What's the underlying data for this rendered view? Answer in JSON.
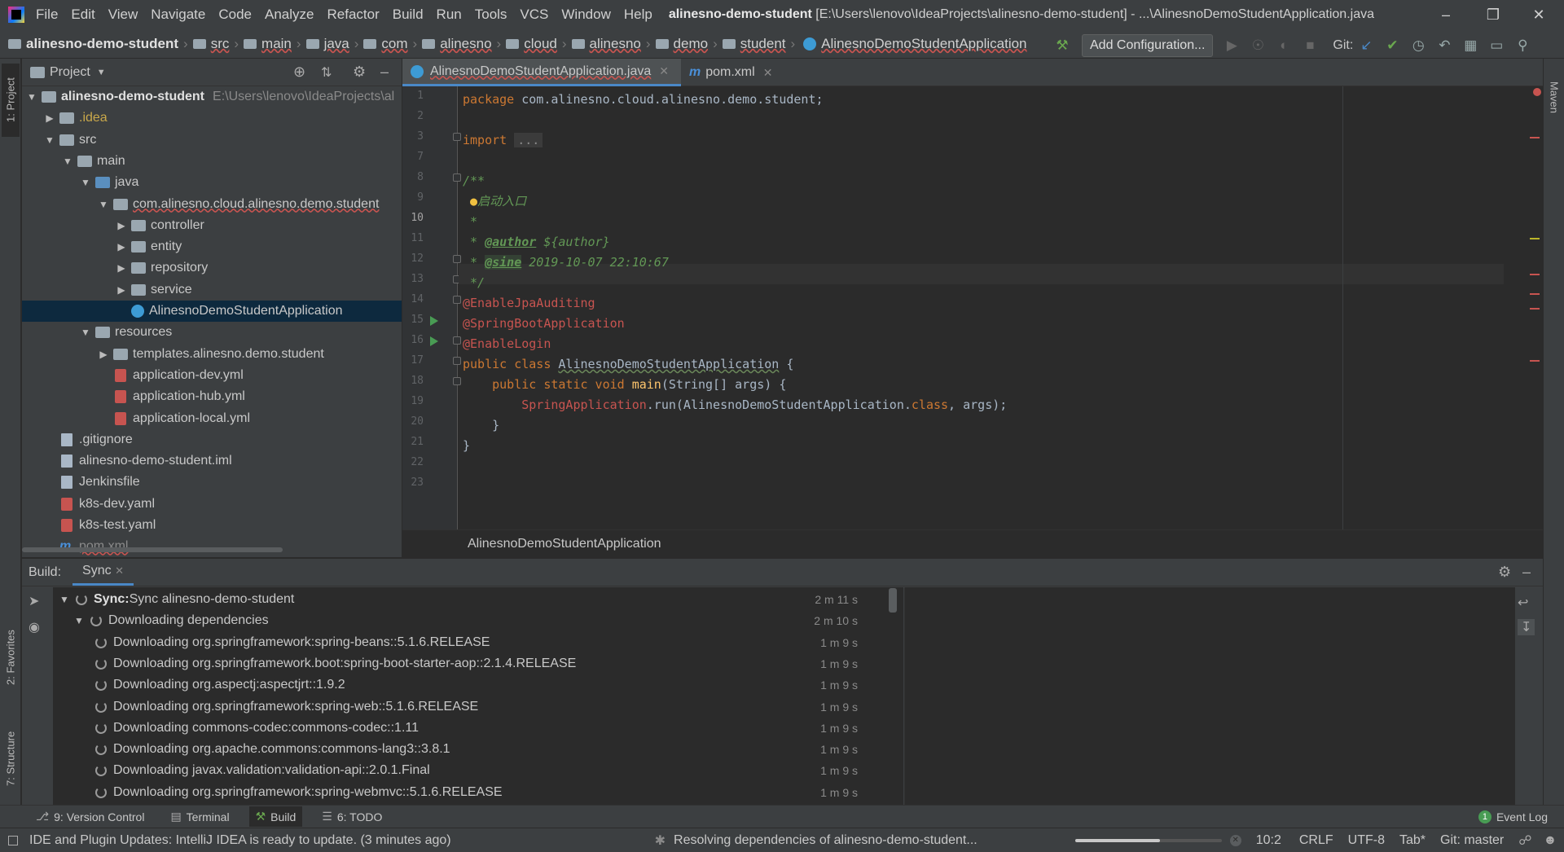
{
  "titlebar": {
    "menus": [
      "File",
      "Edit",
      "View",
      "Navigate",
      "Code",
      "Analyze",
      "Refactor",
      "Build",
      "Run",
      "Tools",
      "VCS",
      "Window",
      "Help"
    ],
    "project_name": "alinesno-demo-student",
    "project_path": "[E:\\Users\\lenovo\\IdeaProjects\\alinesno-demo-student] - ...\\AlinesnoDemoStudentApplication.java"
  },
  "navbar": {
    "crumbs": [
      "alinesno-demo-student",
      "src",
      "main",
      "java",
      "com",
      "alinesno",
      "cloud",
      "alinesno",
      "demo",
      "student",
      "AlinesnoDemoStudentApplication"
    ],
    "add_config": "Add Configuration...",
    "git_label": "Git:"
  },
  "project": {
    "title": "Project",
    "root_name": "alinesno-demo-student",
    "root_path": "E:\\Users\\lenovo\\IdeaProjects\\al",
    "items": [
      {
        "label": ".idea"
      },
      {
        "label": "src"
      },
      {
        "label": "main"
      },
      {
        "label": "java"
      },
      {
        "label": "com.alinesno.cloud.alinesno.demo.student"
      },
      {
        "label": "controller"
      },
      {
        "label": "entity"
      },
      {
        "label": "repository"
      },
      {
        "label": "service"
      },
      {
        "label": "AlinesnoDemoStudentApplication"
      },
      {
        "label": "resources"
      },
      {
        "label": "templates.alinesno.demo.student"
      },
      {
        "label": "application-dev.yml"
      },
      {
        "label": "application-hub.yml"
      },
      {
        "label": "application-local.yml"
      },
      {
        "label": ".gitignore"
      },
      {
        "label": "alinesno-demo-student.iml"
      },
      {
        "label": "Jenkinsfile"
      },
      {
        "label": "k8s-dev.yaml"
      },
      {
        "label": "k8s-test.yaml"
      },
      {
        "label": "pom.xml"
      }
    ]
  },
  "editor": {
    "tabs": [
      {
        "label": "AlinesnoDemoStudentApplication.java"
      },
      {
        "label": "pom.xml"
      }
    ],
    "line_numbers": [
      "1",
      "2",
      "3",
      "7",
      "8",
      "9",
      "10",
      "11",
      "12",
      "13",
      "14",
      "15",
      "16",
      "17",
      "18",
      "19",
      "20",
      "21",
      "22",
      "23"
    ],
    "code": {
      "l1_kw": "package",
      "l1_rest": " com.alinesno.cloud.alinesno.demo.student;",
      "l3_kw": "import",
      "l3_fold": "...",
      "l8": "/**",
      "l9": "启动入口",
      "l10": " *",
      "l11_tag": "@author",
      "l11_rest": " ${author}",
      "l12_tag": "@sine",
      "l12_rest": " 2019-10-07 22:10:67",
      "l13": " */",
      "l14": "@EnableJpaAuditing",
      "l15": "@SpringBootApplication",
      "l16": "@EnableLogin",
      "l17_kw": "public class",
      "l17_name": "AlinesnoDemoStudentApplication",
      "l17_rest": " {",
      "l18_kw": "public static void",
      "l18_fn": "main",
      "l18_rest": "(String[] args) {",
      "l19_cls": "SpringApplication",
      "l19_a": ".run(AlinesnoDemoStudentApplication.",
      "l19_kw": "class",
      "l19_b": ", args);",
      "l20": "    }",
      "l21": "}"
    },
    "breadcrumb": "AlinesnoDemoStudentApplication"
  },
  "build": {
    "label": "Build:",
    "tab": "Sync",
    "rows": [
      {
        "bold": "Sync:",
        "text": " Sync alinesno-demo-student",
        "time": "2 m 11 s"
      },
      {
        "text": "Downloading dependencies",
        "time": "2 m 10 s"
      },
      {
        "text": "Downloading org.springframework:spring-beans::5.1.6.RELEASE",
        "time": "1 m 9 s"
      },
      {
        "text": "Downloading org.springframework.boot:spring-boot-starter-aop::2.1.4.RELEASE",
        "time": "1 m 9 s"
      },
      {
        "text": "Downloading org.aspectj:aspectjrt::1.9.2",
        "time": "1 m 9 s"
      },
      {
        "text": "Downloading org.springframework:spring-web::5.1.6.RELEASE",
        "time": "1 m 9 s"
      },
      {
        "text": "Downloading commons-codec:commons-codec::1.11",
        "time": "1 m 9 s"
      },
      {
        "text": "Downloading org.apache.commons:commons-lang3::3.8.1",
        "time": "1 m 9 s"
      },
      {
        "text": "Downloading javax.validation:validation-api::2.0.1.Final",
        "time": "1 m 9 s"
      },
      {
        "text": "Downloading org.springframework:spring-webmvc::5.1.6.RELEASE",
        "time": "1 m 9 s"
      }
    ]
  },
  "sidebar_tabs": {
    "project": "1: Project",
    "favorites": "2: Favorites",
    "structure": "7: Structure",
    "maven": "Maven"
  },
  "tooltabs": {
    "vcs": "9: Version Control",
    "terminal": "Terminal",
    "build": "Build",
    "todo": "6: TODO",
    "event_log": "Event Log",
    "event_count": "1"
  },
  "status": {
    "message": "IDE and Plugin Updates: IntelliJ IDEA is ready to update. (3 minutes ago)",
    "progress_text": "Resolving dependencies of alinesno-demo-student...",
    "progress_fraction": 0.58,
    "position": "10:2",
    "line_sep": "CRLF",
    "encoding": "UTF-8",
    "indent": "Tab*",
    "git_branch": "Git: master"
  },
  "colors": {
    "accent": "#4a88c7",
    "error": "#c75450",
    "success": "#499c54"
  }
}
